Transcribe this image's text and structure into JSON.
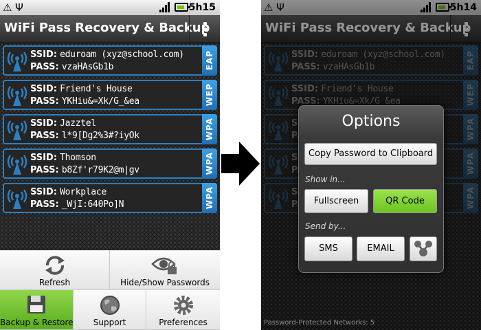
{
  "status_left": {
    "time": "5h15"
  },
  "status_right": {
    "time": "5h14"
  },
  "app": {
    "title": "WiFi Pass Recovery & Backup"
  },
  "labels": {
    "ssid": "SSID:",
    "pass": "PASS:"
  },
  "networks": [
    {
      "ssid": "eduroam (xyz@school.com)",
      "pass": "vzaHAsGb1b",
      "type": "EAP"
    },
    {
      "ssid": "Friend's House",
      "pass": "YKHiu&=Xk/G_&ea",
      "type": "WEP"
    },
    {
      "ssid": "Jazztel",
      "pass": "l*9[Dg2%3#?iyOk",
      "type": "WPA"
    },
    {
      "ssid": "Thomson",
      "pass": "b8Zf'r79K2@m|gv",
      "type": "WPA"
    },
    {
      "ssid": "Workplace",
      "pass": "_WjI:640Po]N",
      "type": "WPA"
    }
  ],
  "menu": {
    "refresh": "Refresh",
    "hide_show": "Hide/Show Passwords",
    "backup": "Backup & Restore",
    "support": "Support",
    "preferences": "Preferences"
  },
  "footer": {
    "status": "Password-Protected Networks: 5"
  },
  "dialog": {
    "title": "Options",
    "copy": "Copy Password to Clipboard",
    "show_in": "Show in...",
    "fullscreen": "Fullscreen",
    "qr": "QR Code",
    "send_by": "Send by...",
    "sms": "SMS",
    "email": "EMAIL"
  },
  "colors": {
    "accent_blue": "#2d7fc0",
    "green": "#6cc420"
  }
}
